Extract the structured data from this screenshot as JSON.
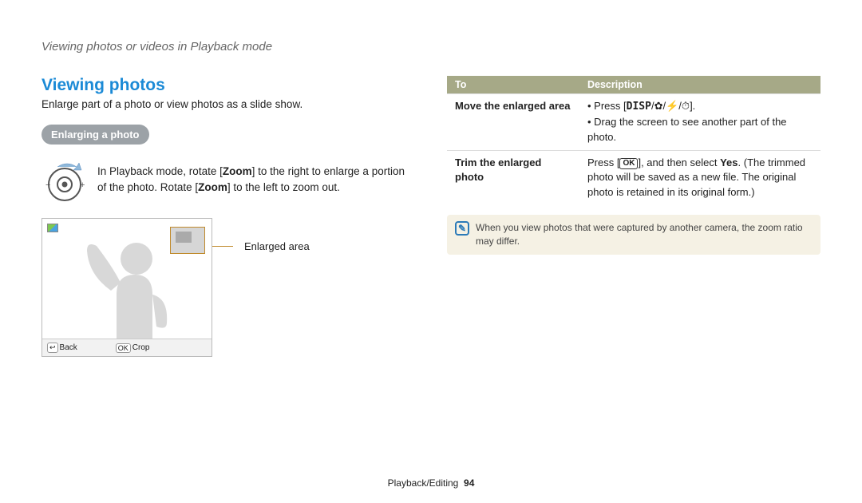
{
  "breadcrumb": "Viewing photos or videos in Playback mode",
  "section_title": "Viewing photos",
  "lead": "Enlarge part of a photo or view photos as a slide show.",
  "pill": "Enlarging a photo",
  "zoom_text_pre": "In Playback mode, rotate [",
  "zoom_text_bold1": "Zoom",
  "zoom_text_mid": "] to the right to enlarge a portion of the photo. Rotate [",
  "zoom_text_bold2": "Zoom",
  "zoom_text_post": "] to the left to zoom out.",
  "enlarged_label": "Enlarged area",
  "preview_bar": {
    "back_icon": "↩",
    "back": "Back",
    "ok": "OK",
    "crop": "Crop"
  },
  "table": {
    "head_to": "To",
    "head_desc": "Description",
    "row1_k": "Move the enlarged area",
    "row1_bullet1_pre": "Press [",
    "row1_disp": "DISP",
    "row1_sep": "/",
    "row1_icon1": "✿",
    "row1_icon2": "⚡",
    "row1_icon3": "⏱",
    "row1_bullet1_post": "].",
    "row1_bullet2": "Drag the screen to see another part of the photo.",
    "row2_k": "Trim the enlarged photo",
    "row2_pre": "Press [",
    "row2_ok": "OK",
    "row2_mid1": "], and then select ",
    "row2_yes": "Yes",
    "row2_mid2": ". (The trimmed photo will be saved as a new file. The original photo is retained in its original form.)"
  },
  "note_icon": "✎",
  "note": "When you view photos that were captured by another camera, the zoom ratio may differ.",
  "footer_section": "Playback/Editing",
  "footer_page": "94"
}
